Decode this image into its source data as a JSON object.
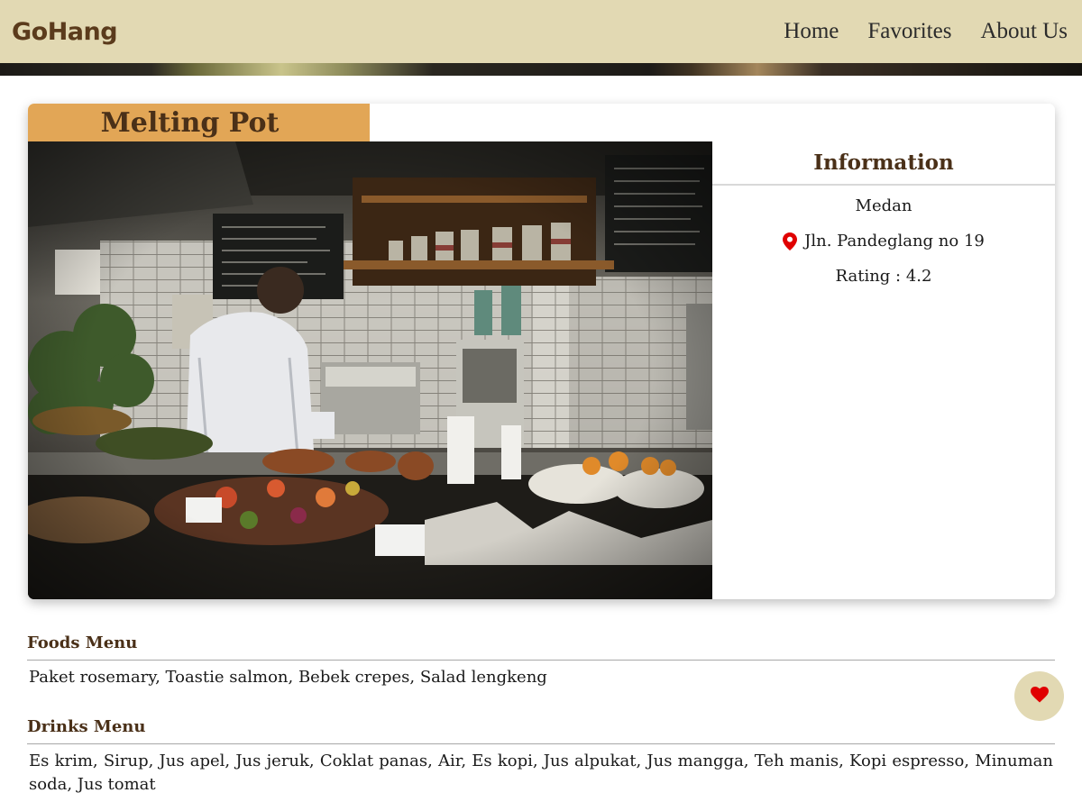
{
  "header": {
    "brand": "GoHang",
    "nav": [
      {
        "label": "Home"
      },
      {
        "label": "Favorites"
      },
      {
        "label": "About Us"
      }
    ]
  },
  "restaurant": {
    "name": "Melting Pot",
    "info_title": "Information",
    "city": "Medan",
    "address": "Jln. Pandeglang no 19",
    "rating": "Rating : 4.2",
    "pin_icon": "map-marker-icon",
    "pin_color": "#e00000"
  },
  "menus": {
    "foods_heading": "Foods Menu",
    "foods_items": "Paket rosemary, Toastie salmon, Bebek crepes, Salad lengkeng",
    "drinks_heading": "Drinks Menu",
    "drinks_items": "Es krim, Sirup, Jus apel, Jus jeruk, Coklat panas, Air, Es kopi, Jus alpukat, Jus mangga, Teh manis, Kopi espresso, Minuman soda, Jus tomat"
  },
  "favorite_button": {
    "icon": "heart-icon",
    "icon_color": "#e00000"
  },
  "colors": {
    "header_bg": "#e2d9b3",
    "brand": "#5b3b1c",
    "tab_bg": "#e2a656",
    "heading": "#4a3018"
  }
}
